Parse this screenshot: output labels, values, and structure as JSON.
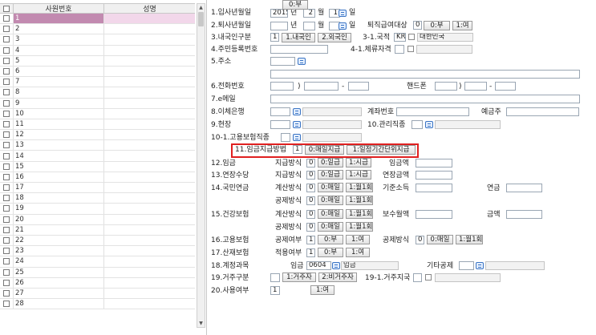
{
  "grid": {
    "headers": [
      "사원번호",
      "성명"
    ],
    "rows": [
      "1",
      "2",
      "3",
      "4",
      "5",
      "6",
      "7",
      "8",
      "9",
      "10",
      "11",
      "12",
      "13",
      "14",
      "15",
      "16",
      "17",
      "18",
      "19",
      "20",
      "21",
      "22",
      "23",
      "24",
      "25",
      "26",
      "27",
      "28"
    ],
    "selected_index": 0
  },
  "form": {
    "f1": {
      "label": "1.입사년월일",
      "year": "2015",
      "year_unit": "년",
      "month": "2",
      "month_unit": "월",
      "day": "1",
      "day_unit": "일"
    },
    "f2": {
      "label": "2.퇴사년월일",
      "year_unit": "년",
      "month_unit": "월",
      "day_unit": "일",
      "target_label": "퇴직급여대상",
      "target_value": "0",
      "opt0": "0:부",
      "opt1": "1:여"
    },
    "f3": {
      "label": "3.내국인구분",
      "value": "1",
      "opt1": "1.내국인",
      "opt2": "2.외국인",
      "nation_label": "3-1.국적",
      "nation_code": "KR",
      "nation_name": "대한민국"
    },
    "f4": {
      "label": "4.주민등록번호",
      "stay_label": "4-1.체류자격"
    },
    "f5": {
      "label": "5.주소"
    },
    "f6": {
      "label": "6.전화번호",
      "paren": ")",
      "dash1": "-",
      "mobile_label": "핸드폰",
      "dash2": "-"
    },
    "f7": {
      "label": "7.e메일"
    },
    "f8": {
      "label": "8.이체은행",
      "account_label": "계좌번호",
      "holder_label": "예금주"
    },
    "f9": {
      "label": "9.현장",
      "mgmt_label": "10.관리직종"
    },
    "f10_1": {
      "label": "10-1.고용보험직종"
    },
    "f11": {
      "label": "11.임금지급방법",
      "value": "1",
      "opt0": "0:매일지급",
      "opt1": "1:일정기간단위지급"
    },
    "f12": {
      "label": "12.임금",
      "method_label": "지급방식",
      "value": "0",
      "opt0": "0:일급",
      "opt1": "1:시급",
      "amount_label": "임금액"
    },
    "f13": {
      "label": "13.연장수당",
      "method_label": "지급방식",
      "value": "0",
      "opt0": "0:일급",
      "opt1": "1:시급",
      "amount_label": "연장금액"
    },
    "f14": {
      "label": "14.국민연금",
      "calc_label": "계산방식",
      "calc_value": "0",
      "calc_opt0": "0:매일",
      "calc_opt1": "1:월1회",
      "base_label": "기준소득",
      "pension_label": "연금",
      "deduct_label": "공제방식",
      "deduct_value": "0",
      "deduct_opt0": "0:매일",
      "deduct_opt1": "1:월1회"
    },
    "f15": {
      "label": "15.건강보험",
      "calc_label": "계산방식",
      "calc_value": "0",
      "calc_opt0": "0:매일",
      "calc_opt1": "1:월1회",
      "premium_label": "보수월액",
      "amount_label": "금액",
      "deduct_label": "공제방식",
      "deduct_value": "0",
      "deduct_opt0": "0:매일",
      "deduct_opt1": "1:월1회"
    },
    "f16": {
      "label": "16.고용보험",
      "deduct_label": "공제여부",
      "deduct_value": "1",
      "opt0": "0:부",
      "opt1": "1:여",
      "method_label": "공제방식",
      "method_value": "0",
      "m_opt0": "0:매일",
      "m_opt1": "1:월1회"
    },
    "f17": {
      "label": "17.산재보험",
      "apply_label": "적용여부",
      "value": "1",
      "opt0": "0:부",
      "opt1": "1:여"
    },
    "f18": {
      "label": "18.계정과목",
      "wage_label": "임금",
      "code": "0604",
      "code_name": "임금",
      "other_label": "기타공제"
    },
    "f19": {
      "label": "19.거주구분",
      "opt1": "1:거주자",
      "opt2": "2:비거주자",
      "region_label": "19-1.거주지국"
    },
    "f20": {
      "label": "20.사용여부",
      "value": "1",
      "opt0": "0:부",
      "opt1": "1:여"
    }
  }
}
